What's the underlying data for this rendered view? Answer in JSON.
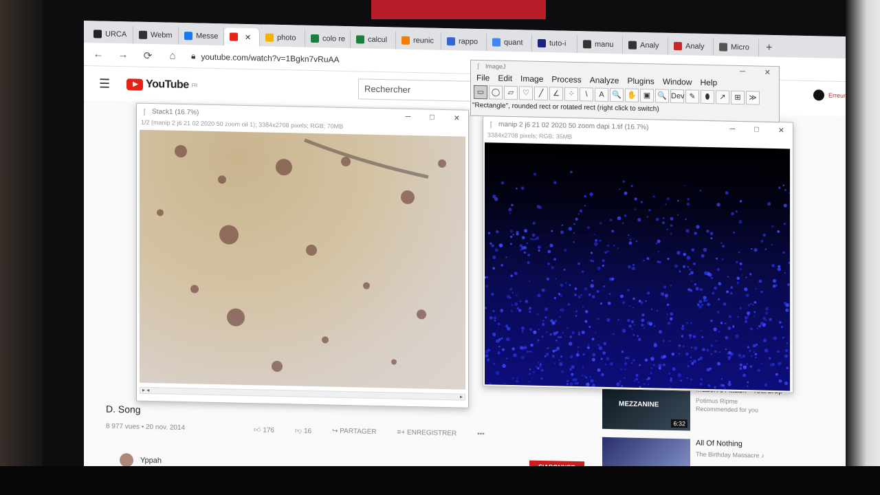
{
  "browser": {
    "tabs": [
      {
        "label": "URCA",
        "color": "#222222"
      },
      {
        "label": "Webm",
        "color": "#333333"
      },
      {
        "label": "Messe",
        "color": "#1877f2"
      },
      {
        "label": "",
        "color": "#e62117",
        "active": true
      },
      {
        "label": "photo",
        "color": "#f4b400"
      },
      {
        "label": "colo re",
        "color": "#1a7f3c"
      },
      {
        "label": "calcul",
        "color": "#1a7f3c"
      },
      {
        "label": "reunic",
        "color": "#f57c00"
      },
      {
        "label": "rappo",
        "color": "#3367d6"
      },
      {
        "label": "quant",
        "color": "#4285f4"
      },
      {
        "label": "tuto-i",
        "color": "#1a237e"
      },
      {
        "label": "manu",
        "color": "#333333"
      },
      {
        "label": "Analy",
        "color": "#333333"
      },
      {
        "label": "Analy",
        "color": "#c62828"
      },
      {
        "label": "Micro",
        "color": "#555555"
      }
    ],
    "new_tab": "+",
    "url": "youtube.com/watch?v=1Bgkn7vRuAA",
    "back": "←",
    "forward": "→",
    "reload": "⟳",
    "home": "⌂"
  },
  "youtube": {
    "logo": "YouTube",
    "region": "FR",
    "search_placeholder": "Rechercher",
    "user_label": "Erreur",
    "video_title": "D. Song",
    "views": "8 977 vues • 20 nov. 2014",
    "likes": "176",
    "dislikes": "16",
    "share": "PARTAGER",
    "save": "ENREGISTRER",
    "more": "•••",
    "channel": "Yppah",
    "subscribe": "S'ABONNER",
    "recommendations": [
      {
        "title": "Massive Attack - Teardrop",
        "sub": "Potimus Ripme",
        "sub2": "Recommended for you",
        "thumb_text": "MEZZANINE",
        "duration": "6:32"
      },
      {
        "title": "All Of Nothing",
        "sub": "The Birthday Massacre ♪",
        "sub2": "",
        "thumb_text": "",
        "duration": ""
      }
    ]
  },
  "stack_window": {
    "title": "Stack1 (16.7%)",
    "info": "1/2 (manip 2 j6 21 02 2020 50 zoom oil 1); 3384x2708 pixels; RGB; 70MB",
    "minimize": "─",
    "maximize": "□",
    "close": "✕",
    "scroll_left": "▸ ◂",
    "scroll_right": "▸"
  },
  "dapi_window": {
    "title": "manip 2 j6 21 02 2020 50 zoom dapi 1.tif (16.7%)",
    "info": "3384x2708 pixels; RGB; 35MB",
    "minimize": "─",
    "maximize": "□",
    "close": "✕"
  },
  "imagej": {
    "title": "ImageJ",
    "menus": [
      "File",
      "Edit",
      "Image",
      "Process",
      "Analyze",
      "Plugins",
      "Window",
      "Help"
    ],
    "tools": [
      "▭",
      "◯",
      "▱",
      "♡",
      "╱",
      "∠",
      "⁘",
      "\\",
      "A",
      "🔍",
      "✋",
      "▣",
      "🔍",
      "Dev",
      "✎",
      "⬮",
      "↗",
      "⊞",
      "≫"
    ],
    "status": "\"Rectangle\", rounded rect or rotated rect (right click to switch)",
    "minimize": "─",
    "close": "✕"
  }
}
